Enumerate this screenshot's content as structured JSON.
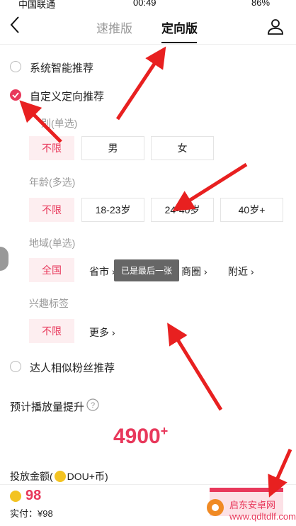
{
  "status_bar": {
    "carrier": "中国联通",
    "time": "00:49",
    "battery": "86%"
  },
  "header": {
    "tabs": [
      "速推版",
      "定向版"
    ]
  },
  "options": {
    "smart": "系统智能推荐",
    "custom": "自定义定向推荐",
    "similar": "达人相似粉丝推荐"
  },
  "gender": {
    "label": "别(单选)",
    "items": [
      "不限",
      "男",
      "女"
    ]
  },
  "age": {
    "label": "年龄(多选)",
    "items": [
      "不限",
      "18-23岁",
      "24-40岁",
      "40岁+"
    ]
  },
  "region": {
    "label": "地域(单选)",
    "all": "全国",
    "province": "省市",
    "biz": "商圈",
    "nearby": "附近"
  },
  "interest": {
    "label": "兴趣标签",
    "all": "不限",
    "more": "更多"
  },
  "toast": "已是最后一张",
  "estimate": {
    "label": "预计播放量提升",
    "value": "4900",
    "plus": "+"
  },
  "budget": {
    "label": "投放金额(",
    "currency": "DOU+币)"
  },
  "footer": {
    "amount": "98",
    "paid": "实付：¥98"
  },
  "watermark": "启东安卓网\nwww.qdltdlf.com",
  "colors": {
    "accent": "#e8385b",
    "arrow": "#e82020"
  }
}
